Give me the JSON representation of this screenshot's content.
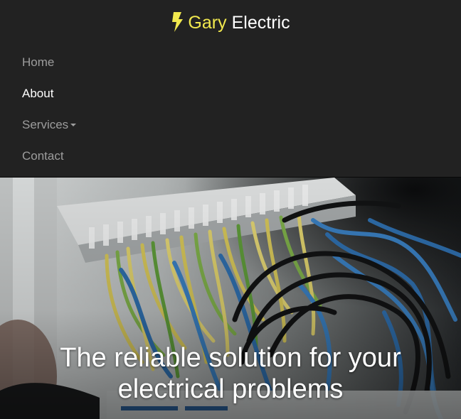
{
  "brand": {
    "icon": "lightning-bolt-icon",
    "accent_text": "Gary",
    "text": "Electric",
    "accent_color": "#f2e94e"
  },
  "nav": {
    "items": [
      {
        "label": "Home",
        "active": false
      },
      {
        "label": "About",
        "active": true
      },
      {
        "label": "Services",
        "active": false,
        "dropdown": true
      },
      {
        "label": "Contact",
        "active": false
      }
    ]
  },
  "hero": {
    "heading_line1": "The reliable solution for your",
    "heading_line2": "electrical problems"
  },
  "colors": {
    "navbar_bg": "#222222",
    "nav_text": "#9d9d9d",
    "nav_active_text": "#ffffff"
  }
}
